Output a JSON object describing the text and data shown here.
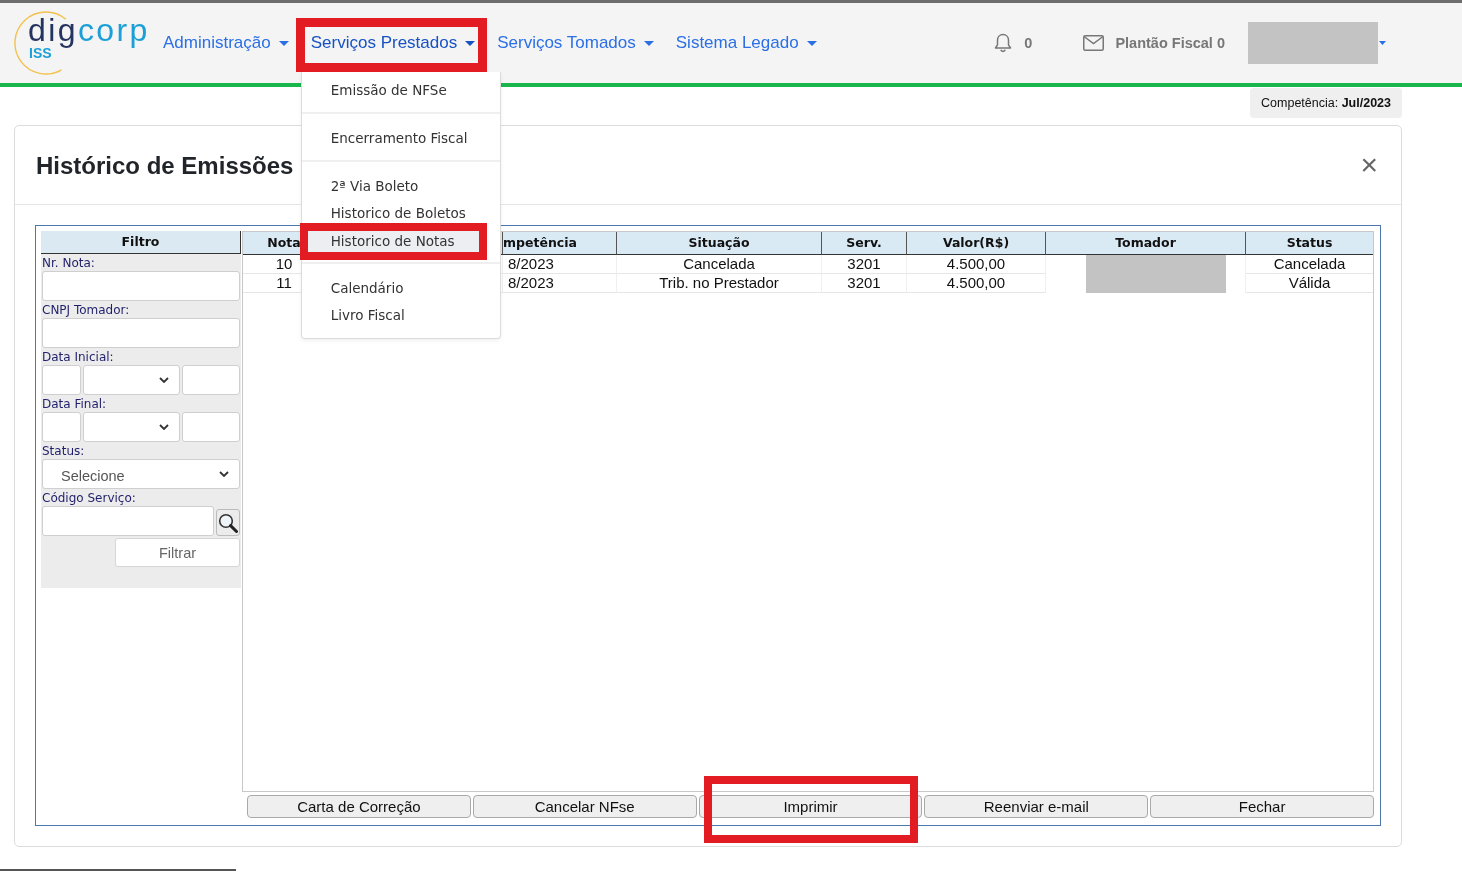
{
  "navbar": {
    "logo": {
      "wordmark_parts": [
        "dig",
        "corp"
      ],
      "subtitle": "ISS"
    },
    "menu_items": [
      {
        "label": "Administração",
        "expanded": false,
        "highlighted": false
      },
      {
        "label": "Serviços Prestados",
        "expanded": true,
        "highlighted": true,
        "menu": {
          "groups": [
            {
              "items": [
                {
                  "label": "Emissão de NFSe",
                  "selected": false,
                  "highlighted": false
                }
              ]
            },
            {
              "items": [
                {
                  "label": "Encerramento Fiscal",
                  "selected": false,
                  "highlighted": false
                }
              ]
            },
            {
              "items": [
                {
                  "label": "2ª Via Boleto",
                  "selected": false,
                  "highlighted": false
                },
                {
                  "label": "Historico de Boletos",
                  "selected": false,
                  "highlighted": false
                },
                {
                  "label": "Historico de Notas",
                  "selected": true,
                  "highlighted": true
                }
              ]
            },
            {
              "items": [
                {
                  "label": "Calendário",
                  "selected": false,
                  "highlighted": false
                },
                {
                  "label": "Livro Fiscal",
                  "selected": false,
                  "highlighted": false
                }
              ]
            }
          ]
        }
      },
      {
        "label": "Serviços Tomados",
        "expanded": false,
        "highlighted": false
      },
      {
        "label": "Sistema Legado",
        "expanded": false,
        "highlighted": false
      }
    ],
    "notifications": {
      "count": "0"
    },
    "messages": {
      "label": "Plantão Fiscal 0"
    }
  },
  "period_badge": "Competência: **Jul/2023**",
  "dialog": {
    "title": "Histórico de Emissões",
    "close": "×",
    "filter": {
      "heading": "Filtro",
      "fields": [
        {
          "kind": "text",
          "label": "Nr. Nota:"
        },
        {
          "kind": "text",
          "label": "CNPJ Tomador:"
        },
        {
          "kind": "date",
          "label": "Data Inicial:"
        },
        {
          "kind": "date",
          "label": "Data Final:"
        },
        {
          "kind": "select",
          "label": "Status:",
          "value": "Selecione"
        },
        {
          "kind": "lookup",
          "label": "Código Serviço:"
        }
      ],
      "button": "Filtrar"
    },
    "table": {
      "columns": [
        {
          "label": "Nota",
          "redacted": false
        },
        {
          "label": "mpetência",
          "redacted": false
        },
        {
          "label": "Situação",
          "redacted": false
        },
        {
          "label": "Serv.",
          "redacted": false
        },
        {
          "label": "Valor(R$)",
          "redacted": false
        },
        {
          "label": "Tomador",
          "redacted": true
        },
        {
          "label": "Status",
          "redacted": false
        }
      ],
      "rows": [
        {
          "cells": [
            "10",
            "8/2023",
            "Cancelada",
            "3201",
            "4.500,00",
            "Cancelada"
          ]
        },
        {
          "cells": [
            "11",
            "8/2023",
            "Trib. no Prestador",
            "3201",
            "4.500,00",
            "Válida"
          ]
        }
      ]
    },
    "actions": [
      {
        "label": "Carta de Correção",
        "highlighted": false
      },
      {
        "label": "Cancelar NFse",
        "highlighted": false
      },
      {
        "label": "Imprimir",
        "highlighted": true
      },
      {
        "label": "Reenviar e-mail",
        "highlighted": false
      },
      {
        "label": "Fechar",
        "highlighted": false
      }
    ]
  }
}
